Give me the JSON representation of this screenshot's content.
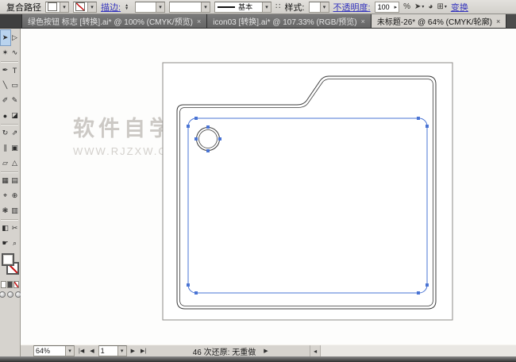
{
  "colors": {
    "selection_blue": "#4a74d4",
    "link_blue": "#3535bd",
    "tab_dark": "#4c4c4c",
    "chrome_gray": "#d6d3ce",
    "none_red": "#c41212"
  },
  "control_bar": {
    "selection_label": "复合路径",
    "stroke_link": "描边:",
    "brush_basic": "基本",
    "width_profile_icon": "∷",
    "style_label": "样式:",
    "opacity_link": "不透明度:",
    "opacity_value": "100",
    "percent_label": "%",
    "select_similar_icon": "➤",
    "recolor_icon": "◕",
    "align_icon": "⊞",
    "transform_link": "变换"
  },
  "tabs": [
    {
      "label": "绿色按钮 标志 [转换].ai* @ 100% (CMYK/预览)",
      "close": "×",
      "active": false
    },
    {
      "label": "icon03 [转换].ai* @ 107.33% (RGB/预览)",
      "close": "×",
      "active": false
    },
    {
      "label": "未标题-26* @ 64% (CMYK/轮廓)",
      "close": "×",
      "active": true
    }
  ],
  "toolbar": {
    "tools": [
      {
        "name": "selection-tool",
        "glyph": "➤",
        "selected": true
      },
      {
        "name": "direct-selection-tool",
        "glyph": "▷",
        "selected": false
      },
      {
        "name": "magic-wand-tool",
        "glyph": "✶",
        "selected": false
      },
      {
        "name": "lasso-tool",
        "glyph": "∿",
        "selected": false
      },
      {
        "name": "pen-tool",
        "glyph": "✒",
        "selected": false
      },
      {
        "name": "type-tool",
        "glyph": "T",
        "selected": false
      },
      {
        "name": "line-segment-tool",
        "glyph": "╲",
        "selected": false
      },
      {
        "name": "rectangle-tool",
        "glyph": "▭",
        "selected": false
      },
      {
        "name": "paintbrush-tool",
        "glyph": "✐",
        "selected": false
      },
      {
        "name": "pencil-tool",
        "glyph": "✎",
        "selected": false
      },
      {
        "name": "blob-brush-tool",
        "glyph": "●",
        "selected": false
      },
      {
        "name": "eraser-tool",
        "glyph": "◪",
        "selected": false
      },
      {
        "name": "rotate-tool",
        "glyph": "↻",
        "selected": false
      },
      {
        "name": "scale-tool",
        "glyph": "⇗",
        "selected": false
      },
      {
        "name": "width-tool",
        "glyph": "∥",
        "selected": false
      },
      {
        "name": "free-transform-tool",
        "glyph": "▣",
        "selected": false
      },
      {
        "name": "shape-builder-tool",
        "glyph": "▱",
        "selected": false
      },
      {
        "name": "perspective-grid-tool",
        "glyph": "△",
        "selected": false
      },
      {
        "name": "mesh-tool",
        "glyph": "▦",
        "selected": false
      },
      {
        "name": "gradient-tool",
        "glyph": "▤",
        "selected": false
      },
      {
        "name": "eyedropper-tool",
        "glyph": "⌖",
        "selected": false
      },
      {
        "name": "blend-tool",
        "glyph": "⊕",
        "selected": false
      },
      {
        "name": "symbol-sprayer-tool",
        "glyph": "❃",
        "selected": false
      },
      {
        "name": "column-graph-tool",
        "glyph": "▥",
        "selected": false
      },
      {
        "name": "artboard-tool",
        "glyph": "◧",
        "selected": false
      },
      {
        "name": "slice-tool",
        "glyph": "✂",
        "selected": false
      },
      {
        "name": "hand-tool",
        "glyph": "☛",
        "selected": false
      },
      {
        "name": "zoom-tool",
        "glyph": "⌕",
        "selected": false
      }
    ]
  },
  "canvas": {
    "watermark_title": "软件自学网",
    "watermark_url": "WWW.RJZXW.COM"
  },
  "status_bar": {
    "zoom_value": "64%",
    "artboard_value": "1",
    "nav_first": "|◀",
    "nav_prev": "◀",
    "nav_next": "▶",
    "nav_last": "▶|",
    "status_text": "46 次还原: 无重做",
    "status_menu_icon": "▶",
    "scroll_left_icon": "◂"
  }
}
